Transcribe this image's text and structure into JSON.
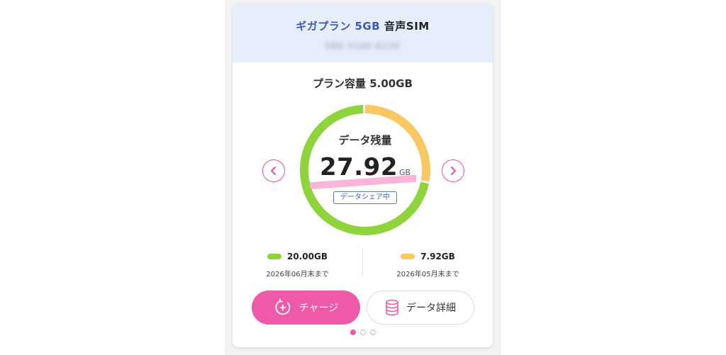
{
  "header": {
    "plan_prefix": "ギガプラン 5GB",
    "plan_suffix": "音声SIM",
    "phone_masked": "080-3100-0220"
  },
  "capacity_label": "プラン容量 5.00GB",
  "gauge": {
    "label": "データ残量",
    "value": "27.92",
    "unit": "GB",
    "share_badge": "データシェア中",
    "segments": [
      {
        "name": "green",
        "amount_gb": 20.0,
        "color": "#8ed43a"
      },
      {
        "name": "yellow",
        "amount_gb": 7.92,
        "color": "#f9c862"
      }
    ]
  },
  "breakdown": [
    {
      "amount": "20.00GB",
      "until": "2026年06月末まで",
      "color": "#8ed43a"
    },
    {
      "amount": "7.92GB",
      "until": "2026年05月末まで",
      "color": "#f9c862"
    }
  ],
  "buttons": {
    "charge": "チャージ",
    "detail": "データ詳細"
  },
  "pager": {
    "total": 3,
    "active": 1
  },
  "colors": {
    "accent": "#ef5aa8",
    "header_bg": "#e6eefc",
    "badge": "#4a62bd"
  }
}
